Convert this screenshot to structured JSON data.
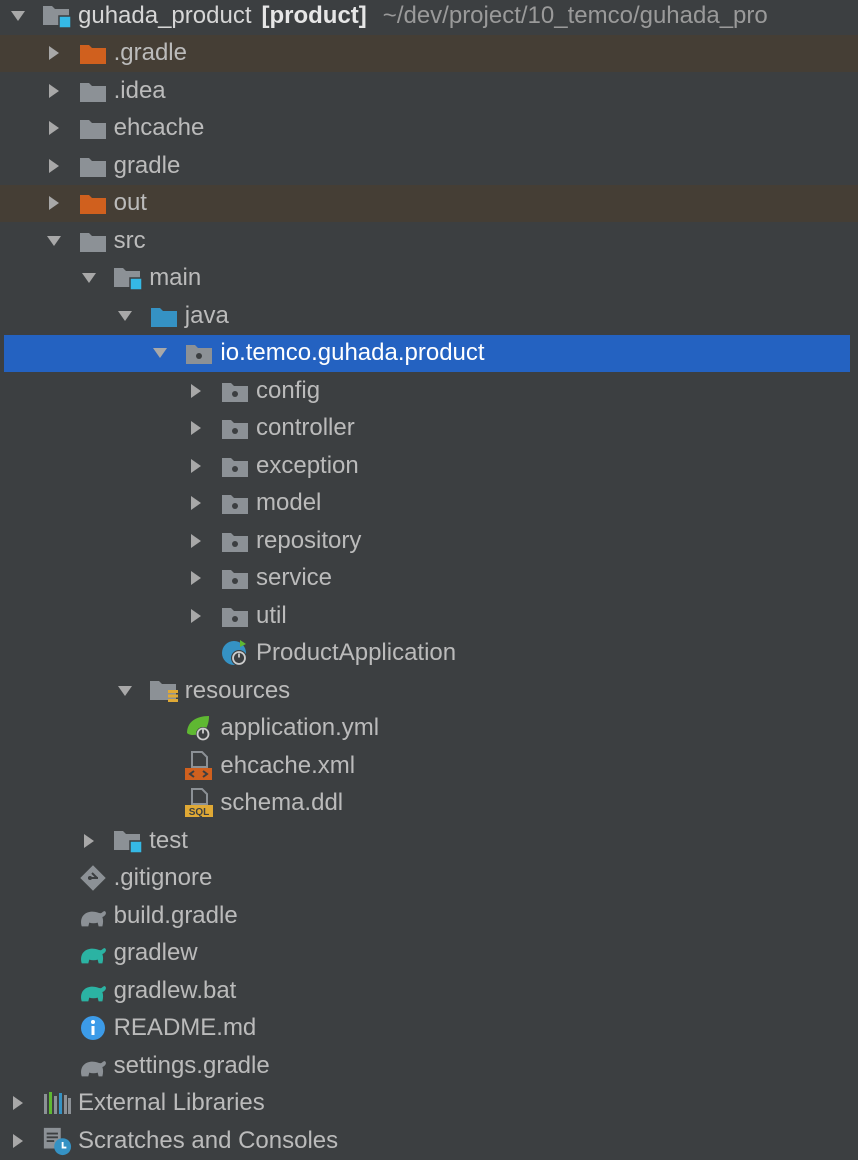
{
  "colors": {
    "background": "#3c3f41",
    "selection": "#2462c1",
    "excluded_row": "#453e35",
    "folder_gray": "#8c9196",
    "folder_excluded": "#d0601e",
    "source_blue": "#3592c4",
    "module_cyan": "#35b9e6",
    "spring_green": "#5fb832",
    "gradle_teal": "#2bb3a3",
    "text": "#bbbbbb"
  },
  "project_view": {
    "rows": [
      {
        "label": "guhada_product",
        "suffix": "[product]",
        "path": "~/dev/project/10_temco/guhada_pro",
        "depth": 0,
        "arrow": "expanded",
        "icon": "module-folder-icon",
        "name": "tree-root-guhada-product"
      },
      {
        "label": ".gradle",
        "depth": 1,
        "arrow": "collapsed",
        "icon": "excluded-folder-icon",
        "excluded": true,
        "name": "tree-item-dot-gradle"
      },
      {
        "label": ".idea",
        "depth": 1,
        "arrow": "collapsed",
        "icon": "folder-icon",
        "name": "tree-item-idea"
      },
      {
        "label": "ehcache",
        "depth": 1,
        "arrow": "collapsed",
        "icon": "folder-icon",
        "name": "tree-item-ehcache-folder"
      },
      {
        "label": "gradle",
        "depth": 1,
        "arrow": "collapsed",
        "icon": "folder-icon",
        "name": "tree-item-gradle-folder"
      },
      {
        "label": "out",
        "depth": 1,
        "arrow": "collapsed",
        "icon": "excluded-folder-icon",
        "excluded": true,
        "name": "tree-item-out"
      },
      {
        "label": "src",
        "depth": 1,
        "arrow": "expanded",
        "icon": "folder-icon",
        "name": "tree-item-src"
      },
      {
        "label": "main",
        "depth": 2,
        "arrow": "expanded",
        "icon": "module-folder-icon",
        "name": "tree-item-main"
      },
      {
        "label": "java",
        "depth": 3,
        "arrow": "expanded",
        "icon": "source-folder-icon",
        "name": "tree-item-java"
      },
      {
        "label": "io.temco.guhada.product",
        "depth": 4,
        "arrow": "expanded",
        "icon": "package-icon",
        "selected": true,
        "name": "tree-item-package-product"
      },
      {
        "label": "config",
        "depth": 5,
        "arrow": "collapsed",
        "icon": "package-icon",
        "name": "tree-item-config"
      },
      {
        "label": "controller",
        "depth": 5,
        "arrow": "collapsed",
        "icon": "package-icon",
        "name": "tree-item-controller"
      },
      {
        "label": "exception",
        "depth": 5,
        "arrow": "collapsed",
        "icon": "package-icon",
        "name": "tree-item-exception"
      },
      {
        "label": "model",
        "depth": 5,
        "arrow": "collapsed",
        "icon": "package-icon",
        "name": "tree-item-model"
      },
      {
        "label": "repository",
        "depth": 5,
        "arrow": "collapsed",
        "icon": "package-icon",
        "name": "tree-item-repository"
      },
      {
        "label": "service",
        "depth": 5,
        "arrow": "collapsed",
        "icon": "package-icon",
        "name": "tree-item-service"
      },
      {
        "label": "util",
        "depth": 5,
        "arrow": "collapsed",
        "icon": "package-icon",
        "name": "tree-item-util"
      },
      {
        "label": "ProductApplication",
        "depth": 5,
        "arrow": "none",
        "icon": "spring-boot-class-icon",
        "name": "tree-item-product-application"
      },
      {
        "label": "resources",
        "depth": 3,
        "arrow": "expanded",
        "icon": "resources-folder-icon",
        "name": "tree-item-resources"
      },
      {
        "label": "application.yml",
        "depth": 4,
        "arrow": "none",
        "icon": "spring-config-icon",
        "name": "tree-item-application-yml"
      },
      {
        "label": "ehcache.xml",
        "depth": 4,
        "arrow": "none",
        "icon": "xml-file-icon",
        "name": "tree-item-ehcache-xml"
      },
      {
        "label": "schema.ddl",
        "depth": 4,
        "arrow": "none",
        "icon": "sql-file-icon",
        "name": "tree-item-schema-ddl"
      },
      {
        "label": "test",
        "depth": 2,
        "arrow": "collapsed",
        "icon": "module-folder-icon",
        "name": "tree-item-test"
      },
      {
        "label": ".gitignore",
        "depth": 1,
        "arrow": "none",
        "icon": "git-file-icon",
        "name": "tree-item-gitignore"
      },
      {
        "label": "build.gradle",
        "depth": 1,
        "arrow": "none",
        "icon": "gradle-file-icon",
        "name": "tree-item-build-gradle"
      },
      {
        "label": "gradlew",
        "depth": 1,
        "arrow": "none",
        "icon": "gradle-wrapper-icon",
        "name": "tree-item-gradlew"
      },
      {
        "label": "gradlew.bat",
        "depth": 1,
        "arrow": "none",
        "icon": "gradle-wrapper-icon",
        "name": "tree-item-gradlew-bat"
      },
      {
        "label": "README.md",
        "depth": 1,
        "arrow": "none",
        "icon": "info-file-icon",
        "name": "tree-item-readme"
      },
      {
        "label": "settings.gradle",
        "depth": 1,
        "arrow": "none",
        "icon": "gradle-file-icon",
        "name": "tree-item-settings-gradle"
      },
      {
        "label": "External Libraries",
        "depth": 0,
        "arrow": "collapsed",
        "icon": "libraries-icon",
        "name": "tree-item-external-libraries"
      },
      {
        "label": "Scratches and Consoles",
        "depth": 0,
        "arrow": "collapsed",
        "icon": "scratches-icon",
        "name": "tree-item-scratches"
      }
    ]
  }
}
